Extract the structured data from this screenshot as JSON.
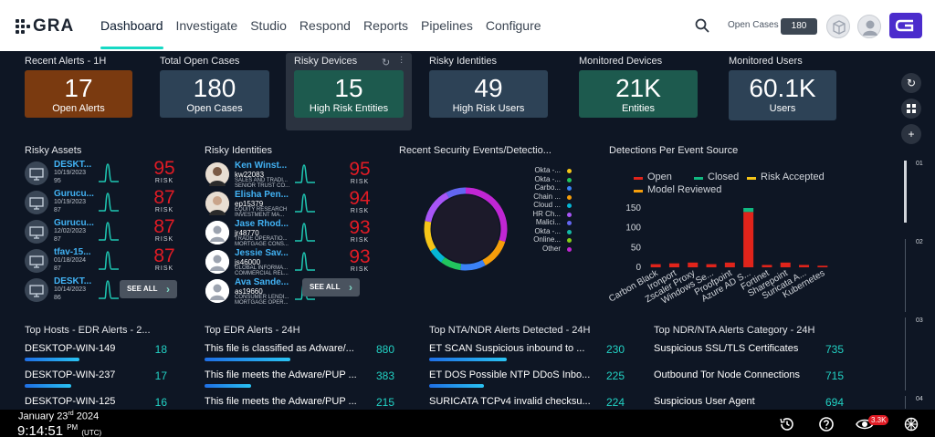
{
  "nav": {
    "logo": "GRA",
    "tabs": [
      "Dashboard",
      "Investigate",
      "Studio",
      "Respond",
      "Reports",
      "Pipelines",
      "Configure"
    ],
    "open_cases_label": "Open Cases",
    "open_cases_value": "180"
  },
  "kpis": [
    {
      "title": "Recent Alerts - 1H",
      "value": "17",
      "label": "Open Alerts",
      "color": "#7a3a10"
    },
    {
      "title": "Total Open Cases",
      "value": "180",
      "label": "Open Cases",
      "color": "#2d4256"
    },
    {
      "title": "Risky Devices",
      "value": "15",
      "label": "High Risk Entities",
      "color": "#1d5a4e"
    },
    {
      "title": "Risky Identities",
      "value": "49",
      "label": "High Risk Users",
      "color": "#2d4256"
    },
    {
      "title": "Monitored Devices",
      "value": "21K",
      "label": "Entities",
      "color": "#1d5a4e"
    },
    {
      "title": "Monitored Users",
      "value": "60.1K",
      "label": "Users",
      "color": "#2d4256"
    }
  ],
  "risky_assets": {
    "title": "Risky Assets",
    "rows": [
      {
        "name": "DESKT...",
        "l1": "10/19/2023",
        "l2": "95",
        "score": "95",
        "risk": "RISK"
      },
      {
        "name": "Gurucu...",
        "l1": "10/19/2023",
        "l2": "87",
        "score": "87",
        "risk": "RISK"
      },
      {
        "name": "Gurucu...",
        "l1": "12/02/2023",
        "l2": "87",
        "score": "87",
        "risk": "RISK"
      },
      {
        "name": "tfav-15...",
        "l1": "01/18/2024",
        "l2": "87",
        "score": "87",
        "risk": "RISK"
      },
      {
        "name": "DESKT...",
        "l1": "10/14/2023",
        "l2": "86",
        "score": "86",
        "risk": "RISK"
      }
    ],
    "see_all": "SEE ALL"
  },
  "risky_identities": {
    "title": "Risky Identities",
    "rows": [
      {
        "name": "Ken Winst...",
        "l1": "kw22083",
        "l2": "SALES AND TRADI...",
        "l3": "SENIOR TRUST CO...",
        "score": "95",
        "risk": "RISK"
      },
      {
        "name": "Elisha Pen...",
        "l1": "ep15379",
        "l2": "EQUITY RESEARCH",
        "l3": "INVESTMENT MA...",
        "score": "94",
        "risk": "RISK"
      },
      {
        "name": "Jase Rhod...",
        "l1": "jr48770",
        "l2": "TRADE OPERATIO...",
        "l3": "MORTGAGE CONS...",
        "score": "93",
        "risk": "RISK"
      },
      {
        "name": "Jessie Sav...",
        "l1": "js46000",
        "l2": "GLOBAL INFORMA...",
        "l3": "COMMERCIAL REL...",
        "score": "93",
        "risk": "RISK"
      },
      {
        "name": "Ava Sande...",
        "l1": "as19660",
        "l2": "CONSUMER LENDI...",
        "l3": "MORTGAGE OPER...",
        "score": "",
        "risk": ""
      }
    ],
    "see_all": "SEE ALL"
  },
  "security_events": {
    "title": "Recent Security Events/Detectio...",
    "legend": [
      {
        "label": "Okta -...",
        "color": "#f5c518"
      },
      {
        "label": "Okta -...",
        "color": "#22c55e"
      },
      {
        "label": "Carbo...",
        "color": "#3b82f6"
      },
      {
        "label": "Chain ...",
        "color": "#f59e0b"
      },
      {
        "label": "Cloud ...",
        "color": "#06b6d4"
      },
      {
        "label": "HR Ch...",
        "color": "#a855f7"
      },
      {
        "label": "Malici...",
        "color": "#6366f1"
      },
      {
        "label": "Okta -...",
        "color": "#14b8a6"
      },
      {
        "label": "Online...",
        "color": "#84cc16"
      },
      {
        "label": "Other",
        "color": "#c026d3"
      }
    ]
  },
  "chart_data": {
    "type": "bar",
    "title": "Detections Per Event Source",
    "legend": [
      "Open",
      "Closed",
      "Risk Accepted",
      "Model Reviewed"
    ],
    "legend_colors": [
      "#e0241b",
      "#10b981",
      "#f5c518",
      "#f59e0b"
    ],
    "categories": [
      "Carbon Black",
      "Ironport",
      "Zscaler Proxy",
      "Windows Se...",
      "Proofpoint",
      "Azure AD S...",
      "Fortinet",
      "Sharepoint",
      "Suricata A...",
      "Kubernetes"
    ],
    "series": [
      {
        "name": "Open",
        "values": [
          8,
          10,
          12,
          8,
          12,
          140,
          6,
          12,
          6,
          4
        ]
      },
      {
        "name": "Closed",
        "values": [
          0,
          0,
          0,
          0,
          0,
          10,
          0,
          0,
          0,
          0
        ]
      }
    ],
    "ylim": [
      0,
      150
    ],
    "yticks": [
      "150",
      "100",
      "50",
      "0"
    ]
  },
  "top_hosts": {
    "title": "Top Hosts - EDR Alerts - 2...",
    "rows": [
      {
        "label": "DESKTOP-WIN-149",
        "value": "18",
        "pct": 0.35
      },
      {
        "label": "DESKTOP-WIN-237",
        "value": "17",
        "pct": 0.3
      },
      {
        "label": "DESKTOP-WIN-125",
        "value": "16",
        "pct": 0.3
      }
    ]
  },
  "top_edr": {
    "title": "Top EDR Alerts - 24H",
    "rows": [
      {
        "label": "This file is classified as Adware/...",
        "value": "880",
        "pct": 0.55
      },
      {
        "label": "This file meets the Adware/PUP ...",
        "value": "383",
        "pct": 0.3
      },
      {
        "label": "This file meets the Adware/PUP ...",
        "value": "215",
        "pct": 0.25
      }
    ]
  },
  "top_nta": {
    "title": "Top NTA/NDR Alerts Detected - 24H",
    "rows": [
      {
        "label": "ET SCAN Suspicious inbound to ...",
        "value": "230",
        "pct": 0.5
      },
      {
        "label": "ET DOS Possible NTP DDoS Inbo...",
        "value": "225",
        "pct": 0.35
      },
      {
        "label": "SURICATA TCPv4 invalid checksu...",
        "value": "224",
        "pct": 0.35
      }
    ]
  },
  "top_ndr_cat": {
    "title": "Top NDR/NTA Alerts Category - 24H",
    "rows": [
      {
        "label": "Suspicious SSL/TLS Certificates",
        "value": "735",
        "pct": 0.0
      },
      {
        "label": "Outbound Tor Node Connections",
        "value": "715",
        "pct": 0.0
      },
      {
        "label": "Suspicious User Agent",
        "value": "694",
        "pct": 0.0
      }
    ]
  },
  "rail": {
    "n1": "01",
    "n2": "02",
    "n3": "03",
    "n4": "04"
  },
  "footer": {
    "date": "January 23",
    "date_suffix": "rd",
    "year": " 2024",
    "time": "9:14:51",
    "ampm": "PM",
    "tz": "(UTC)",
    "badge": "3.3K"
  }
}
